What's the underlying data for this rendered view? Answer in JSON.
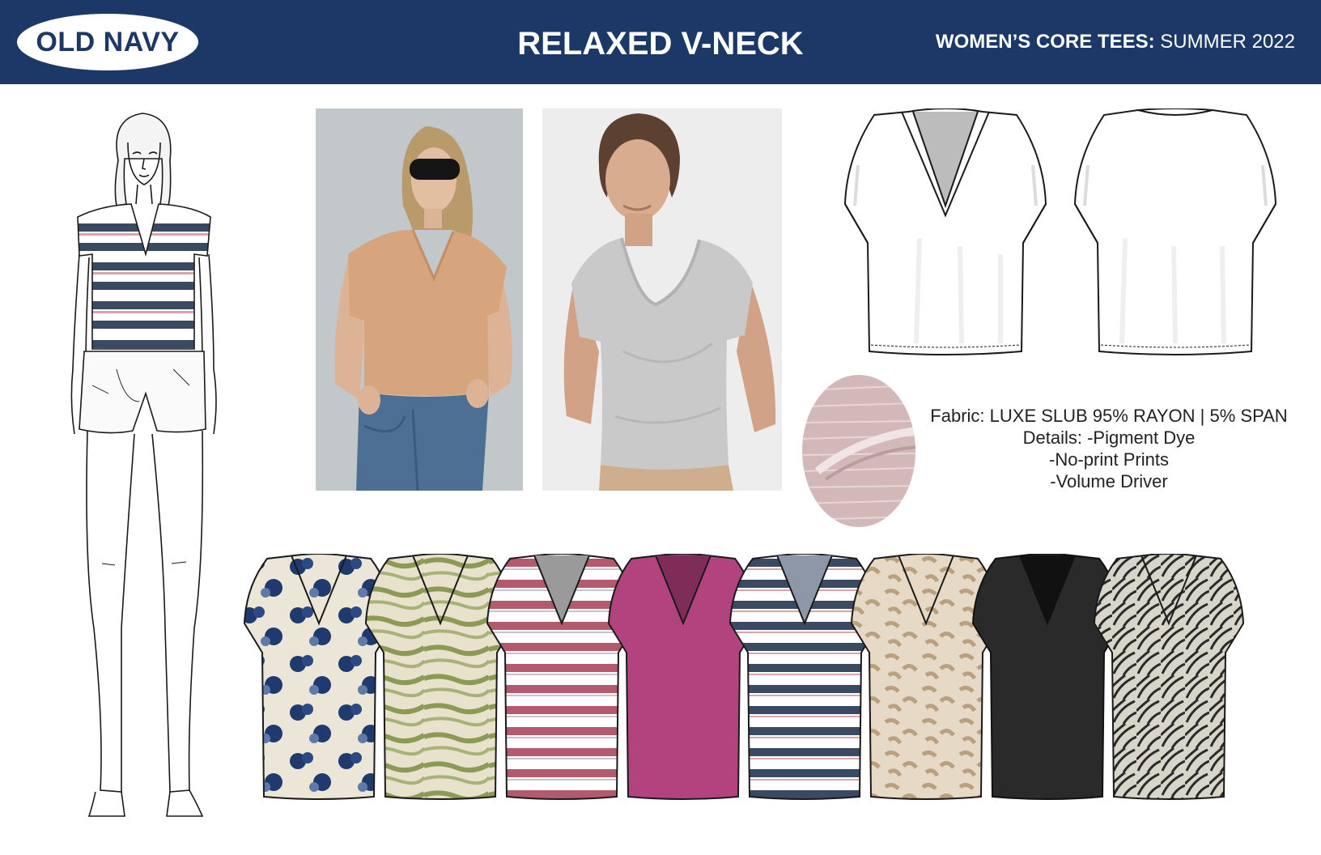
{
  "header": {
    "brand": "OLD NAVY",
    "title": "RELAXED V-NECK",
    "collection": "WOMEN’S CORE TEES:",
    "season": " SUMMER 2022"
  },
  "colors": {
    "header_bg": "#1b3866",
    "stripe_navy": "#3b4a63",
    "stripe_pink": "#b45a6e",
    "magenta": "#b3437f",
    "black": "#2a2a2a",
    "camel": "#d6a47d",
    "heather_grey": "#c9c9c9"
  },
  "specs": {
    "fabric": "Fabric: LUXE SLUB 95% RAYON | 5% SPAN",
    "details": "Details: -Pigment Dye",
    "detail_2": "-No-print Prints",
    "detail_3": "-Volume Driver"
  },
  "colorways": [
    {
      "name": "blue-floral-tie-dye-tee",
      "icon": "tee-icon"
    },
    {
      "name": "olive-tie-dye-tee",
      "icon": "tee-icon"
    },
    {
      "name": "pink-stripe-tee",
      "icon": "tee-icon"
    },
    {
      "name": "magenta-solid-tee",
      "icon": "tee-icon"
    },
    {
      "name": "navy-stripe-tee",
      "icon": "tee-icon"
    },
    {
      "name": "tan-animal-print-tee",
      "icon": "tee-icon"
    },
    {
      "name": "black-solid-tee",
      "icon": "tee-icon"
    },
    {
      "name": "leaf-print-tee",
      "icon": "tee-icon"
    }
  ]
}
